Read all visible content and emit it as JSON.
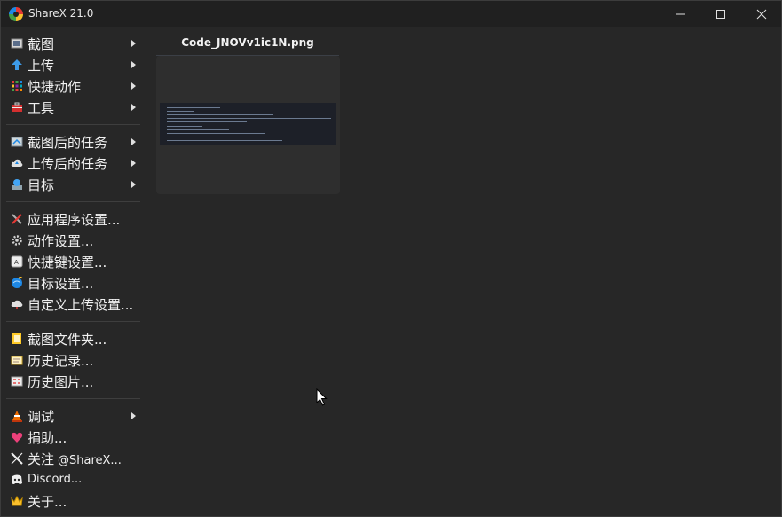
{
  "window": {
    "title": "ShareX 21.0",
    "controls": {
      "minimize": "minimize-icon",
      "maximize": "maximize-icon",
      "close": "close-icon"
    }
  },
  "menu": {
    "groups": [
      [
        {
          "label": "截图",
          "icon": "capture-icon",
          "submenu": true
        },
        {
          "label": "上传",
          "icon": "upload-arrow-icon",
          "submenu": true
        },
        {
          "label": "快捷动作",
          "icon": "workflow-grid-icon",
          "submenu": true
        },
        {
          "label": "工具",
          "icon": "toolbox-icon",
          "submenu": true
        }
      ],
      [
        {
          "label": "截图后的任务",
          "icon": "after-capture-icon",
          "submenu": true
        },
        {
          "label": "上传后的任务",
          "icon": "after-upload-cloud-icon",
          "submenu": true
        },
        {
          "label": "目标",
          "icon": "destinations-icon",
          "submenu": true
        }
      ],
      [
        {
          "label": "应用程序设置...",
          "icon": "wrench-screwdriver-icon",
          "submenu": false
        },
        {
          "label": "动作设置...",
          "icon": "gear-icon",
          "submenu": false
        },
        {
          "label": "快捷键设置...",
          "icon": "keyboard-key-icon",
          "submenu": false
        },
        {
          "label": "目标设置...",
          "icon": "globe-pencil-icon",
          "submenu": false
        },
        {
          "label": "自定义上传设置...",
          "icon": "cloud-icon",
          "submenu": false
        }
      ],
      [
        {
          "label": "截图文件夹...",
          "icon": "folder-icon",
          "submenu": false
        },
        {
          "label": "历史记录...",
          "icon": "history-card-icon",
          "submenu": false
        },
        {
          "label": "历史图片...",
          "icon": "image-history-icon",
          "submenu": false
        }
      ],
      [
        {
          "label": "调试",
          "icon": "traffic-cone-icon",
          "submenu": true
        },
        {
          "label": "捐助...",
          "icon": "heart-icon",
          "submenu": false
        },
        {
          "label": "关注",
          "handle": "@ShareX...",
          "icon": "x-logo-icon",
          "submenu": false
        },
        {
          "label": "Discord...",
          "icon": "discord-icon",
          "submenu": false
        },
        {
          "label": "关于...",
          "icon": "crown-icon",
          "submenu": false
        }
      ]
    ]
  },
  "thumbnail": {
    "filename": "Code_JNOVv1ic1N.png"
  },
  "colors": {
    "background": "#272727",
    "titlebar": "#202020",
    "text": "#f0f0f0"
  }
}
